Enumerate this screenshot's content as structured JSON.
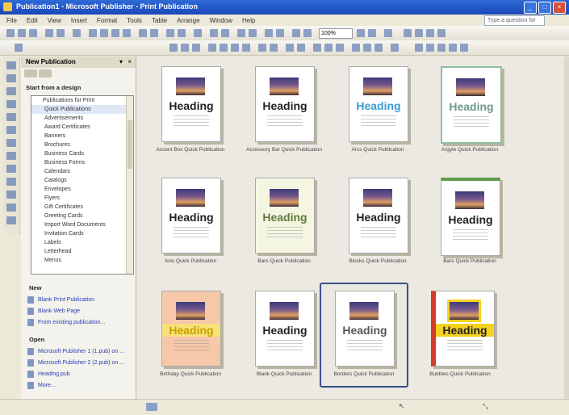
{
  "window": {
    "title": "Publication1 - Microsoft Publisher - Print Publication"
  },
  "menu": [
    "File",
    "Edit",
    "View",
    "Insert",
    "Format",
    "Tools",
    "Table",
    "Arrange",
    "Window",
    "Help"
  ],
  "help_placeholder": "Type a question for help",
  "toolbar": {
    "zoom": "100%"
  },
  "taskpane": {
    "title": "New Publication",
    "by_design_label": "Start from a design",
    "tree": [
      "Publications for Print",
      "Quick Publications",
      "Advertisements",
      "Award Certificates",
      "Banners",
      "Brochures",
      "Business Cards",
      "Business Forms",
      "Calendars",
      "Catalogs",
      "Envelopes",
      "Flyers",
      "Gift Certificates",
      "Greeting Cards",
      "Import Word Documents",
      "Invitation Cards",
      "Labels",
      "Letterhead",
      "Menus"
    ],
    "new_label": "New",
    "new_links": [
      "Blank Print Publication",
      "Blank Web Page",
      "From existing publication..."
    ],
    "open_label": "Open",
    "open_links": [
      "Microsoft Publisher 1 (1.pub) on ...",
      "Microsoft Publisher 2 (2.pub) on ...",
      "Heading.pub",
      "More..."
    ]
  },
  "gallery": [
    {
      "caption": "Accent Box Quick Publication",
      "heading": "Heading"
    },
    {
      "caption": "Accessory Bar Quick Publication",
      "heading": "Heading"
    },
    {
      "caption": "Arcs Quick Publication",
      "heading": "Heading"
    },
    {
      "caption": "Argyle Quick Publication",
      "heading": "Heading"
    },
    {
      "caption": "Axis Quick Publication",
      "heading": "Heading"
    },
    {
      "caption": "Bars Quick Publication",
      "heading": "Heading"
    },
    {
      "caption": "Blocks Quick Publication",
      "heading": "Heading"
    },
    {
      "caption": "Bars Quick Publication",
      "heading": "Heading"
    },
    {
      "caption": "Birthday Quick Publication",
      "heading": "Heading"
    },
    {
      "caption": "Blank Quick Publication",
      "heading": "Heading"
    },
    {
      "caption": "Borders Quick Publication",
      "heading": "Heading"
    },
    {
      "caption": "Bubbles Quick Publication",
      "heading": "Heading"
    }
  ]
}
